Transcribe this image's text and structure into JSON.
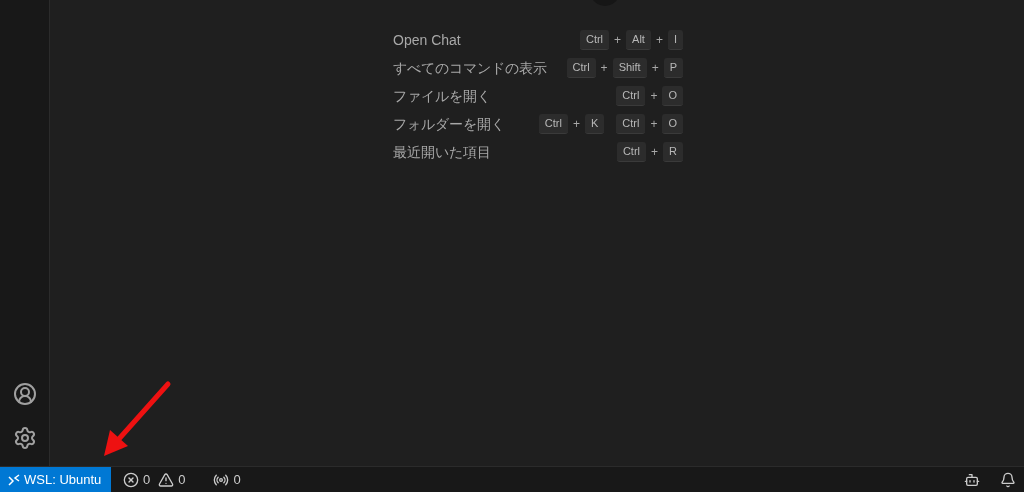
{
  "shortcuts": {
    "separator": "+",
    "items": [
      {
        "label": "Open Chat",
        "chords": [
          [
            "Ctrl",
            "Alt",
            "I"
          ]
        ]
      },
      {
        "label": "すべてのコマンドの表示",
        "chords": [
          [
            "Ctrl",
            "Shift",
            "P"
          ]
        ]
      },
      {
        "label": "ファイルを開く",
        "chords": [
          [
            "Ctrl",
            "O"
          ]
        ]
      },
      {
        "label": "フォルダーを開く",
        "chords": [
          [
            "Ctrl",
            "K"
          ],
          [
            "Ctrl",
            "O"
          ]
        ]
      },
      {
        "label": "最近開いた項目",
        "chords": [
          [
            "Ctrl",
            "R"
          ]
        ]
      }
    ]
  },
  "status_bar": {
    "remote": "WSL: Ubuntu",
    "errors": "0",
    "warnings": "0",
    "ports": "0"
  }
}
